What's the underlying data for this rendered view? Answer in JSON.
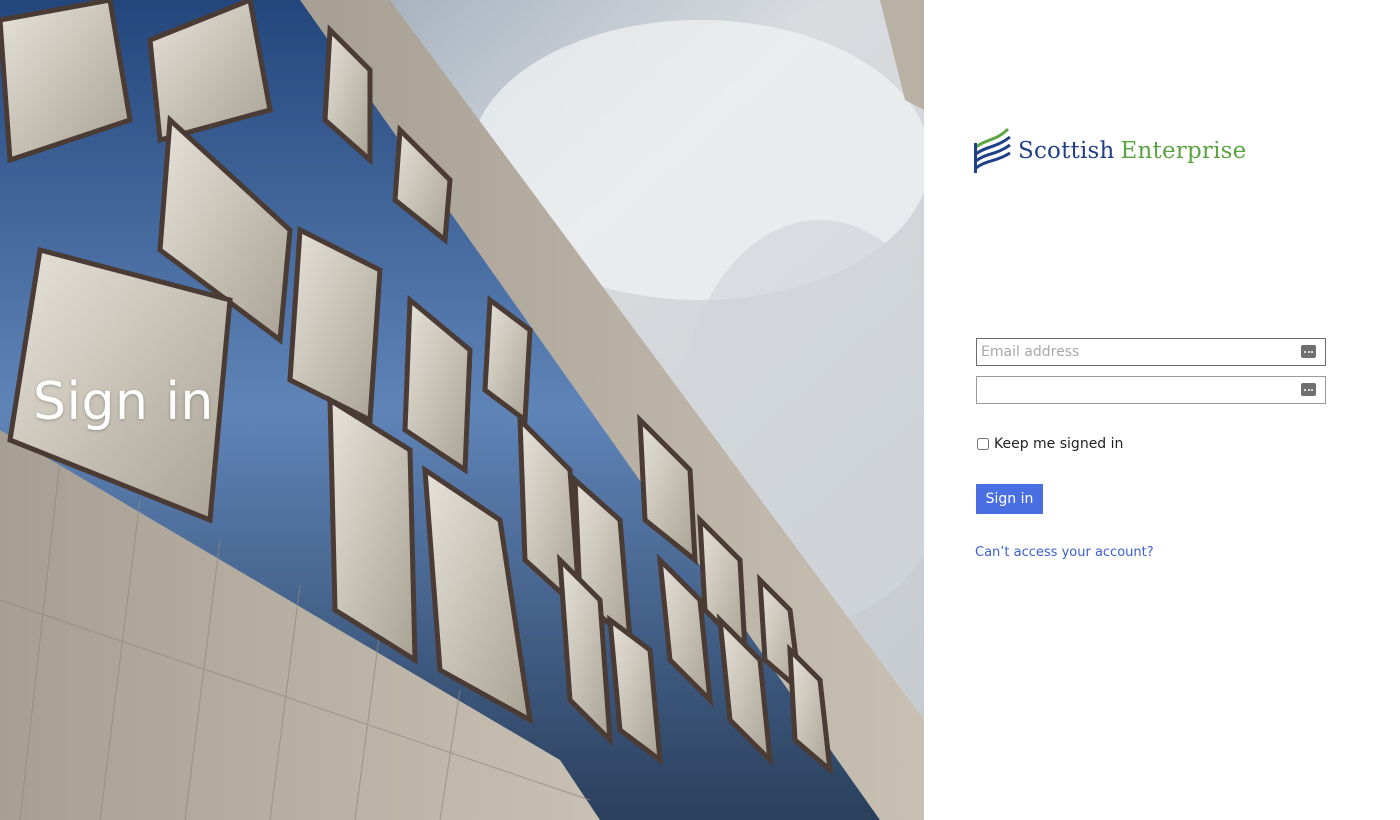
{
  "hero": {
    "title": "Sign in",
    "image": "office-building-facade-photo"
  },
  "brand": {
    "word1": "Scottish",
    "word2": "Enterprise",
    "primary_color": "#1f3f87",
    "secondary_color": "#5ca443"
  },
  "form": {
    "email_placeholder": "Email address",
    "email_value": "",
    "password_placeholder": "",
    "password_value": "",
    "field_icon": "password-manager-icon",
    "keep_signed_in_label": "Keep me signed in",
    "keep_signed_in_checked": false,
    "signin_label": "Sign in",
    "signin_color": "#4a6fe3",
    "help_link": "Can’t access your account?"
  }
}
